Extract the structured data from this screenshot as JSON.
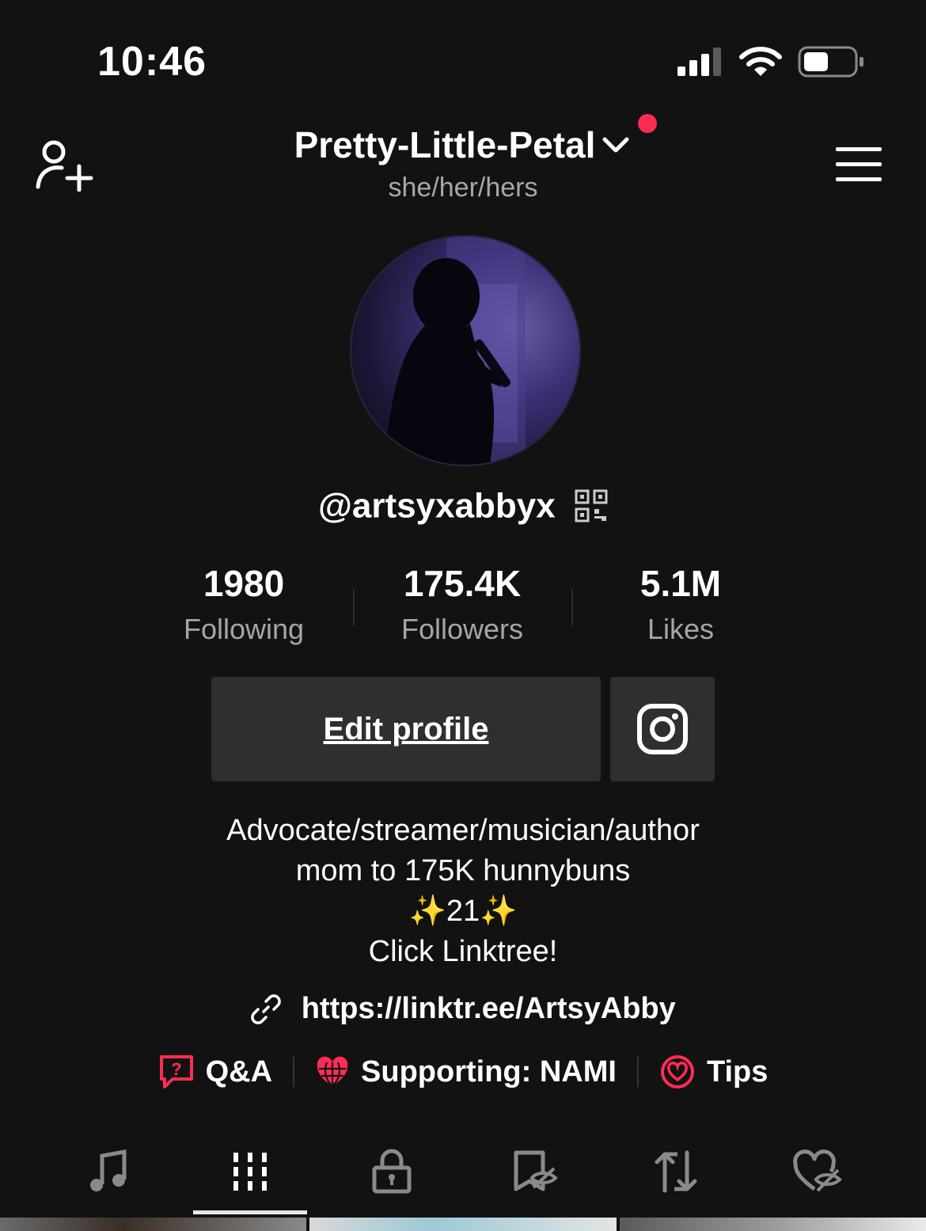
{
  "status_bar": {
    "time": "10:46"
  },
  "header": {
    "title": "Pretty-Little-Petal",
    "pronouns": "she/her/hers",
    "notification_color": "#fe2c55"
  },
  "profile": {
    "username": "@artsyxabbyx",
    "stats": [
      {
        "value": "1980",
        "label": "Following"
      },
      {
        "value": "175.4K",
        "label": "Followers"
      },
      {
        "value": "5.1M",
        "label": "Likes"
      }
    ],
    "edit_profile_label": "Edit profile",
    "bio": [
      "Advocate/streamer/musician/author",
      "mom to 175K hunnybuns",
      "✨21✨",
      "Click Linktree!"
    ],
    "link": "https://linktr.ee/ArtsyAbby",
    "chips": [
      {
        "label": "Q&A",
        "icon": "qa-icon"
      },
      {
        "label": "Supporting: NAMI",
        "icon": "globe-heart-icon"
      },
      {
        "label": "Tips",
        "icon": "tips-icon"
      }
    ]
  },
  "tabs": [
    {
      "icon": "music-icon"
    },
    {
      "icon": "videos-grid-icon",
      "active": true
    },
    {
      "icon": "lock-icon"
    },
    {
      "icon": "favorites-hidden-icon"
    },
    {
      "icon": "reposts-icon"
    },
    {
      "icon": "liked-hidden-icon"
    }
  ],
  "colors": {
    "accent": "#fe2c55",
    "background": "#121212",
    "button": "#2f2f2f",
    "muted": "#a6a6a6"
  }
}
